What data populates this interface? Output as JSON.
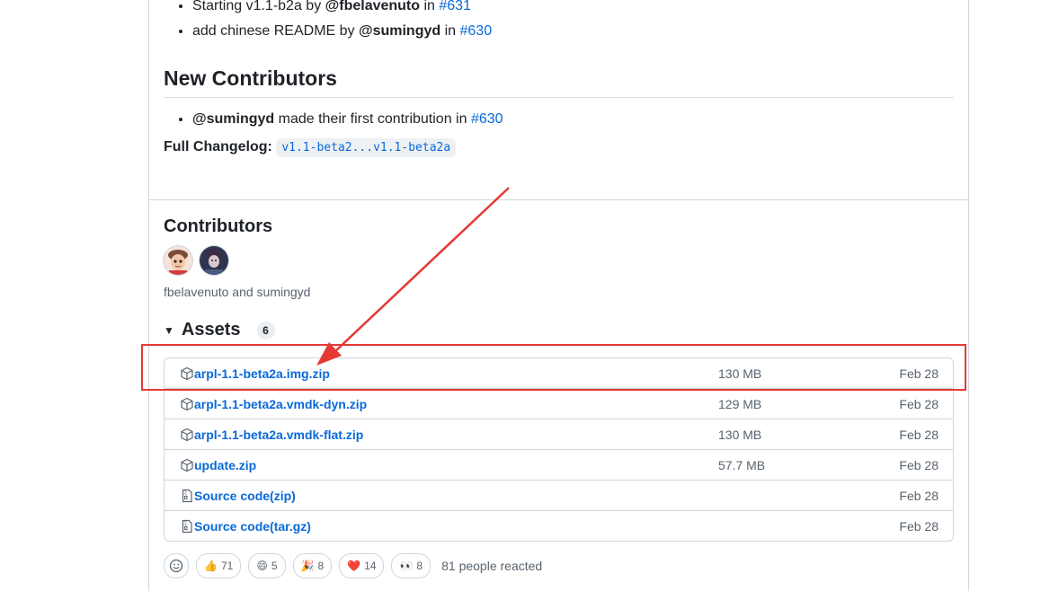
{
  "changes": [
    {
      "prefix": "Starting v1.1-b2a by ",
      "user": "@fbelavenuto",
      "mid": " in ",
      "pr": "#631"
    },
    {
      "prefix": "add chinese README by ",
      "user": "@sumingyd",
      "mid": " in ",
      "pr": "#630"
    }
  ],
  "new_contributors": {
    "heading": "New Contributors",
    "items": [
      {
        "user": "@sumingyd",
        "text": " made their first contribution in ",
        "pr": "#630"
      }
    ]
  },
  "changelog": {
    "label": "Full Changelog:",
    "compare": "v1.1-beta2...v1.1-beta2a"
  },
  "contributors": {
    "heading": "Contributors",
    "names": "fbelavenuto and sumingyd"
  },
  "assets": {
    "heading": "Assets",
    "count": "6",
    "rows": [
      {
        "name": "arpl-1.1-beta2a.img.zip",
        "suffix": "",
        "size": "130 MB",
        "date": "Feb 28",
        "icon": "package-icon"
      },
      {
        "name": "arpl-1.1-beta2a.vmdk-dyn.zip",
        "suffix": "",
        "size": "129 MB",
        "date": "Feb 28",
        "icon": "package-icon"
      },
      {
        "name": "arpl-1.1-beta2a.vmdk-flat.zip",
        "suffix": "",
        "size": "130 MB",
        "date": "Feb 28",
        "icon": "package-icon"
      },
      {
        "name": "update.zip",
        "suffix": "",
        "size": "57.7 MB",
        "date": "Feb 28",
        "icon": "package-icon"
      },
      {
        "name": "Source code",
        "suffix": " (zip)",
        "size": "",
        "date": "Feb 28",
        "icon": "file-zip-icon"
      },
      {
        "name": "Source code",
        "suffix": " (tar.gz)",
        "size": "",
        "date": "Feb 28",
        "icon": "file-zip-icon"
      }
    ]
  },
  "reactions": {
    "items": [
      {
        "emoji": "👍",
        "count": "71"
      },
      {
        "emoji": "😄",
        "count": "5"
      },
      {
        "emoji": "🎉",
        "count": "8"
      },
      {
        "emoji": "❤️",
        "count": "14"
      },
      {
        "emoji": "👀",
        "count": "8"
      }
    ],
    "summary": "81 people reacted"
  },
  "colors": {
    "link": "#0969da",
    "annotation": "#e53935"
  }
}
